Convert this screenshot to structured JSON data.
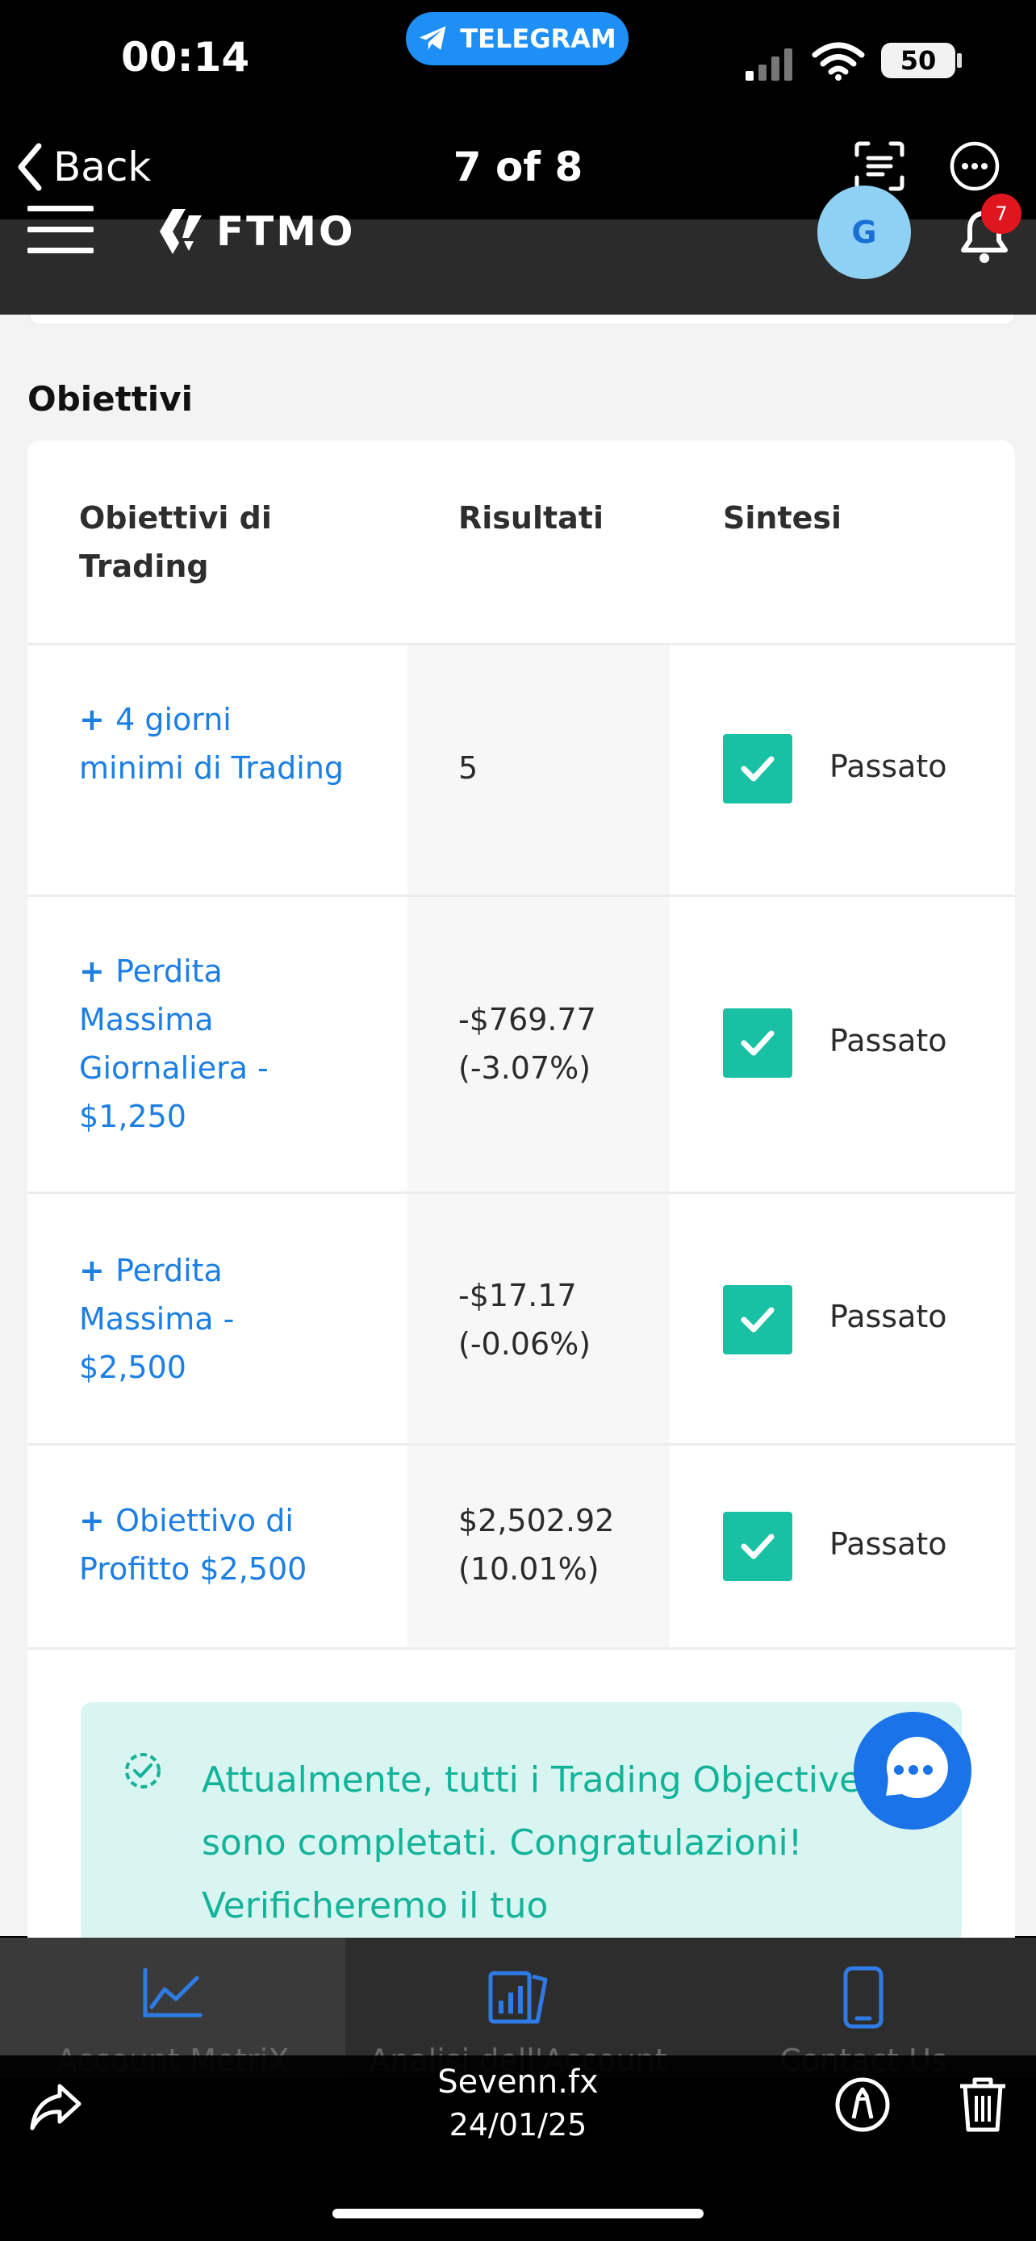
{
  "status_bar": {
    "time": "00:14",
    "source_app": "TELEGRAM",
    "battery": "50"
  },
  "viewer": {
    "back_label": "Back",
    "counter": "7 of 8",
    "author": "Sevenn.fx",
    "date": "24/01/25"
  },
  "app_header": {
    "brand": "FTMO",
    "avatar_initial": "G",
    "notification_count": "7"
  },
  "objectives": {
    "title": "Obiettivi",
    "columns": [
      "Obiettivi di Trading",
      "Risultati",
      "Sintesi"
    ],
    "rows": [
      {
        "objective": "4 giorni minimi di Trading",
        "result": "5",
        "status": "Passato"
      },
      {
        "objective": "Perdita Massima Giornaliera - $1,250",
        "result": "-$769.77 (-3.07%)",
        "status": "Passato"
      },
      {
        "objective": "Perdita Massima - $2,500",
        "result": "-$17.17 (-0.06%)",
        "status": "Passato"
      },
      {
        "objective": "Obiettivo di Profitto $2,500",
        "result": "$2,502.92 (10.01%)",
        "status": "Passato"
      }
    ],
    "success_message": "Attualmente, tutti i Trading Objectives sono completati. Congratulazioni! Verificheremo il tuo"
  },
  "bottom_nav": [
    {
      "label": "Account MetriX",
      "icon": "chart-line-icon",
      "active": true
    },
    {
      "label": "Analisi dell'Account",
      "icon": "analysis-icon",
      "active": false
    },
    {
      "label": "Contact Us",
      "icon": "phone-icon",
      "active": false
    }
  ],
  "colors": {
    "accent_blue": "#1d7fe2",
    "success_teal": "#19c1a4",
    "success_bg": "#d9f5f1",
    "telegram_blue": "#1d8ff5"
  }
}
